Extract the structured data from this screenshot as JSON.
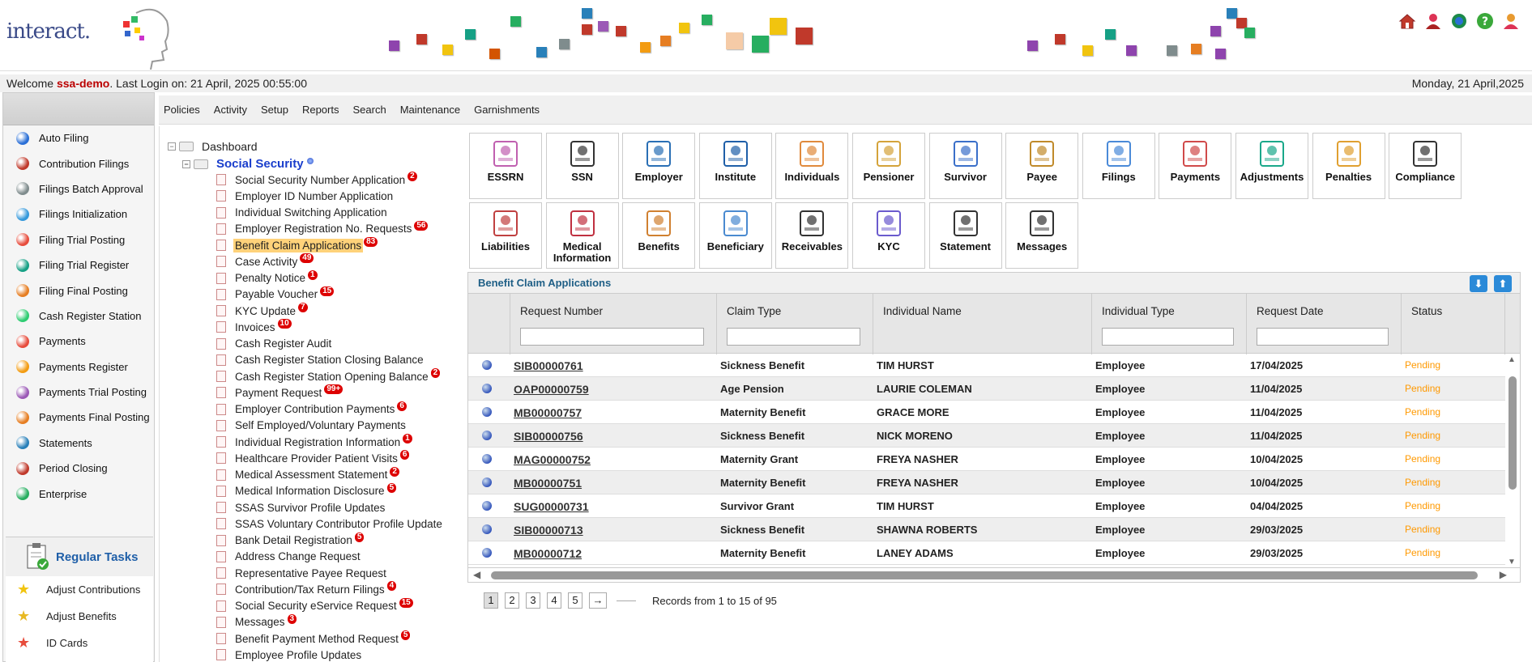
{
  "header": {
    "logo_text": "interact.",
    "icons": [
      "home-icon",
      "user-icon",
      "refresh-icon",
      "help-icon",
      "logout-icon"
    ]
  },
  "welcome": {
    "prefix": "Welcome ",
    "user": "ssa-demo",
    "last_login": ". Last Login on: 21 April, 2025 00:55:00",
    "date": "Monday, 21 April,2025"
  },
  "sidebar": {
    "items": [
      {
        "label": "Auto Filing",
        "color": "#2a6fd6"
      },
      {
        "label": "Contribution Filings",
        "color": "#c0392b"
      },
      {
        "label": "Filings Batch Approval",
        "color": "#7f8c8d"
      },
      {
        "label": "Filings Initialization",
        "color": "#3498db"
      },
      {
        "label": "Filing Trial Posting",
        "color": "#e74c3c"
      },
      {
        "label": "Filing Trial Register",
        "color": "#16a085"
      },
      {
        "label": "Filing Final Posting",
        "color": "#e67e22"
      },
      {
        "label": "Cash Register Station",
        "color": "#2ecc71"
      },
      {
        "label": "Payments",
        "color": "#e74c3c"
      },
      {
        "label": "Payments Register",
        "color": "#f39c12"
      },
      {
        "label": "Payments Trial Posting",
        "color": "#9b59b6"
      },
      {
        "label": "Payments Final Posting",
        "color": "#e67e22"
      },
      {
        "label": "Statements",
        "color": "#2980b9"
      },
      {
        "label": "Period Closing",
        "color": "#c0392b"
      },
      {
        "label": "Enterprise",
        "color": "#27ae60"
      }
    ],
    "tasks_title": "Regular Tasks",
    "tasks": [
      "Adjust Contributions",
      "Adjust Benefits",
      "ID Cards"
    ]
  },
  "menubar": [
    "Policies",
    "Activity",
    "Setup",
    "Reports",
    "Search",
    "Maintenance",
    "Garnishments"
  ],
  "tree": {
    "root": "Dashboard",
    "section": "Social Security",
    "items": [
      {
        "label": "Social Security Number Application",
        "badge": "2"
      },
      {
        "label": "Employer ID Number Application",
        "badge": ""
      },
      {
        "label": "Individual Switching Application",
        "badge": ""
      },
      {
        "label": "Employer Registration No. Requests",
        "badge": "56"
      },
      {
        "label": "Benefit Claim Applications",
        "badge": "83",
        "selected": true
      },
      {
        "label": "Case Activity",
        "badge": "49"
      },
      {
        "label": "Penalty Notice",
        "badge": "1"
      },
      {
        "label": "Payable Voucher",
        "badge": "15"
      },
      {
        "label": "KYC Update",
        "badge": "7"
      },
      {
        "label": "Invoices",
        "badge": "10"
      },
      {
        "label": "Cash Register Audit",
        "badge": ""
      },
      {
        "label": "Cash Register Station Closing Balance",
        "badge": ""
      },
      {
        "label": "Cash Register Station Opening Balance",
        "badge": "2"
      },
      {
        "label": "Payment Request",
        "badge": "99+"
      },
      {
        "label": "Employer Contribution Payments",
        "badge": "6"
      },
      {
        "label": "Self Employed/Voluntary Payments",
        "badge": ""
      },
      {
        "label": "Individual Registration Information",
        "badge": "1"
      },
      {
        "label": "Healthcare Provider Patient Visits",
        "badge": "6"
      },
      {
        "label": "Medical Assessment Statement",
        "badge": "2"
      },
      {
        "label": "Medical Information Disclosure",
        "badge": "5"
      },
      {
        "label": "SSAS Survivor Profile Updates",
        "badge": ""
      },
      {
        "label": "SSAS Voluntary Contributor Profile Update",
        "badge": ""
      },
      {
        "label": "Bank Detail Registration",
        "badge": "5"
      },
      {
        "label": "Address Change Request",
        "badge": ""
      },
      {
        "label": "Representative Payee Request",
        "badge": ""
      },
      {
        "label": "Contribution/Tax Return Filings",
        "badge": "4"
      },
      {
        "label": "Social Security eService Request",
        "badge": "15"
      },
      {
        "label": "Messages",
        "badge": "3"
      },
      {
        "label": "Benefit Payment Method Request",
        "badge": "5"
      },
      {
        "label": "Employee Profile Updates",
        "badge": ""
      }
    ]
  },
  "tiles": {
    "row1": [
      {
        "label": "ESSRN",
        "color": "#c060b0"
      },
      {
        "label": "SSN",
        "color": "#333"
      },
      {
        "label": "Employer",
        "color": "#2a6fb5"
      },
      {
        "label": "Institute",
        "color": "#1f5fa8"
      },
      {
        "label": "Individuals",
        "color": "#e08a3c"
      },
      {
        "label": "Pensioner",
        "color": "#d4a33a"
      },
      {
        "label": "Survivor",
        "color": "#3a6fc9"
      },
      {
        "label": "Payee",
        "color": "#c08a2a"
      },
      {
        "label": "Filings",
        "color": "#4a8ad8"
      },
      {
        "label": "Payments",
        "color": "#d04a4a"
      },
      {
        "label": "Adjustments",
        "color": "#1aa88a"
      },
      {
        "label": "Penalties",
        "color": "#e0a030"
      },
      {
        "label": "Compliance",
        "color": "#333"
      }
    ],
    "row2": [
      {
        "label": "Liabilities",
        "color": "#c04040"
      },
      {
        "label": "Medical Information",
        "color": "#c03040"
      },
      {
        "label": "Benefits",
        "color": "#d08030"
      },
      {
        "label": "Beneficiary",
        "color": "#4a8ad0"
      },
      {
        "label": "Receivables",
        "color": "#333"
      },
      {
        "label": "KYC",
        "color": "#6a5acd"
      },
      {
        "label": "Statement",
        "color": "#333"
      },
      {
        "label": "Messages",
        "color": "#333"
      }
    ]
  },
  "grid": {
    "title": "Benefit Claim Applications",
    "columns": [
      "Request Number",
      "Claim Type",
      "Individual Name",
      "Individual Type",
      "Request Date",
      "Status"
    ],
    "rows": [
      [
        "SIB00000761",
        "Sickness Benefit",
        "TIM HURST",
        "Employee",
        "17/04/2025",
        "Pending"
      ],
      [
        "OAP00000759",
        "Age Pension",
        "LAURIE COLEMAN",
        "Employee",
        "11/04/2025",
        "Pending"
      ],
      [
        "MB00000757",
        "Maternity Benefit",
        "GRACE MORE",
        "Employee",
        "11/04/2025",
        "Pending"
      ],
      [
        "SIB00000756",
        "Sickness Benefit",
        "NICK MORENO",
        "Employee",
        "11/04/2025",
        "Pending"
      ],
      [
        "MAG00000752",
        "Maternity Grant",
        "FREYA NASHER",
        "Employee",
        "10/04/2025",
        "Pending"
      ],
      [
        "MB00000751",
        "Maternity Benefit",
        "FREYA NASHER",
        "Employee",
        "10/04/2025",
        "Pending"
      ],
      [
        "SUG00000731",
        "Survivor Grant",
        "TIM HURST",
        "Employee",
        "04/04/2025",
        "Pending"
      ],
      [
        "SIB00000713",
        "Sickness Benefit",
        "SHAWNA ROBERTS",
        "Employee",
        "29/03/2025",
        "Pending"
      ],
      [
        "MB00000712",
        "Maternity Benefit",
        "LANEY ADAMS",
        "Employee",
        "29/03/2025",
        "Pending"
      ]
    ],
    "pages": [
      "1",
      "2",
      "3",
      "4",
      "5",
      "→"
    ],
    "records": "Records from 1 to 15 of 95"
  }
}
